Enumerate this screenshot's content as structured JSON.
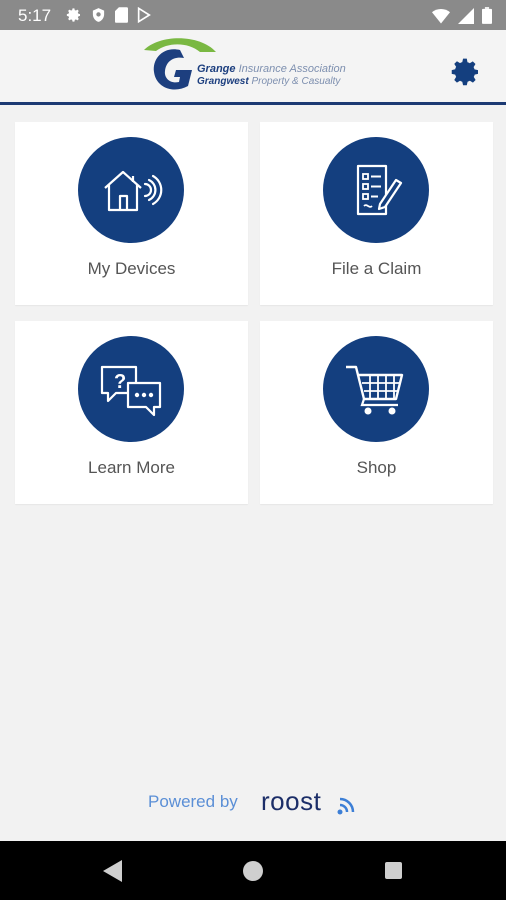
{
  "status_bar": {
    "time": "5:17",
    "left_icons": [
      "gear-icon",
      "shield-icon",
      "sd-card-icon",
      "play-store-icon"
    ],
    "right_icons": [
      "wifi-icon",
      "signal-icon",
      "battery-icon"
    ]
  },
  "header": {
    "logo": {
      "brand_bold": "Grange",
      "brand_rest": "Insurance Association",
      "sub_bold": "Grangwest",
      "sub_rest": "Property & Casualty"
    },
    "settings_icon": "gear-icon"
  },
  "tiles": [
    {
      "label": "My Devices",
      "icon": "smart-home-icon"
    },
    {
      "label": "File a Claim",
      "icon": "claim-form-icon"
    },
    {
      "label": "Learn More",
      "icon": "chat-question-icon"
    },
    {
      "label": "Shop",
      "icon": "shopping-cart-icon"
    }
  ],
  "footer": {
    "powered_by": "Powered by",
    "brand": "roost"
  },
  "colors": {
    "brand_blue": "#143f7f",
    "header_rule": "#1c3a73",
    "background": "#f2f2f2"
  }
}
